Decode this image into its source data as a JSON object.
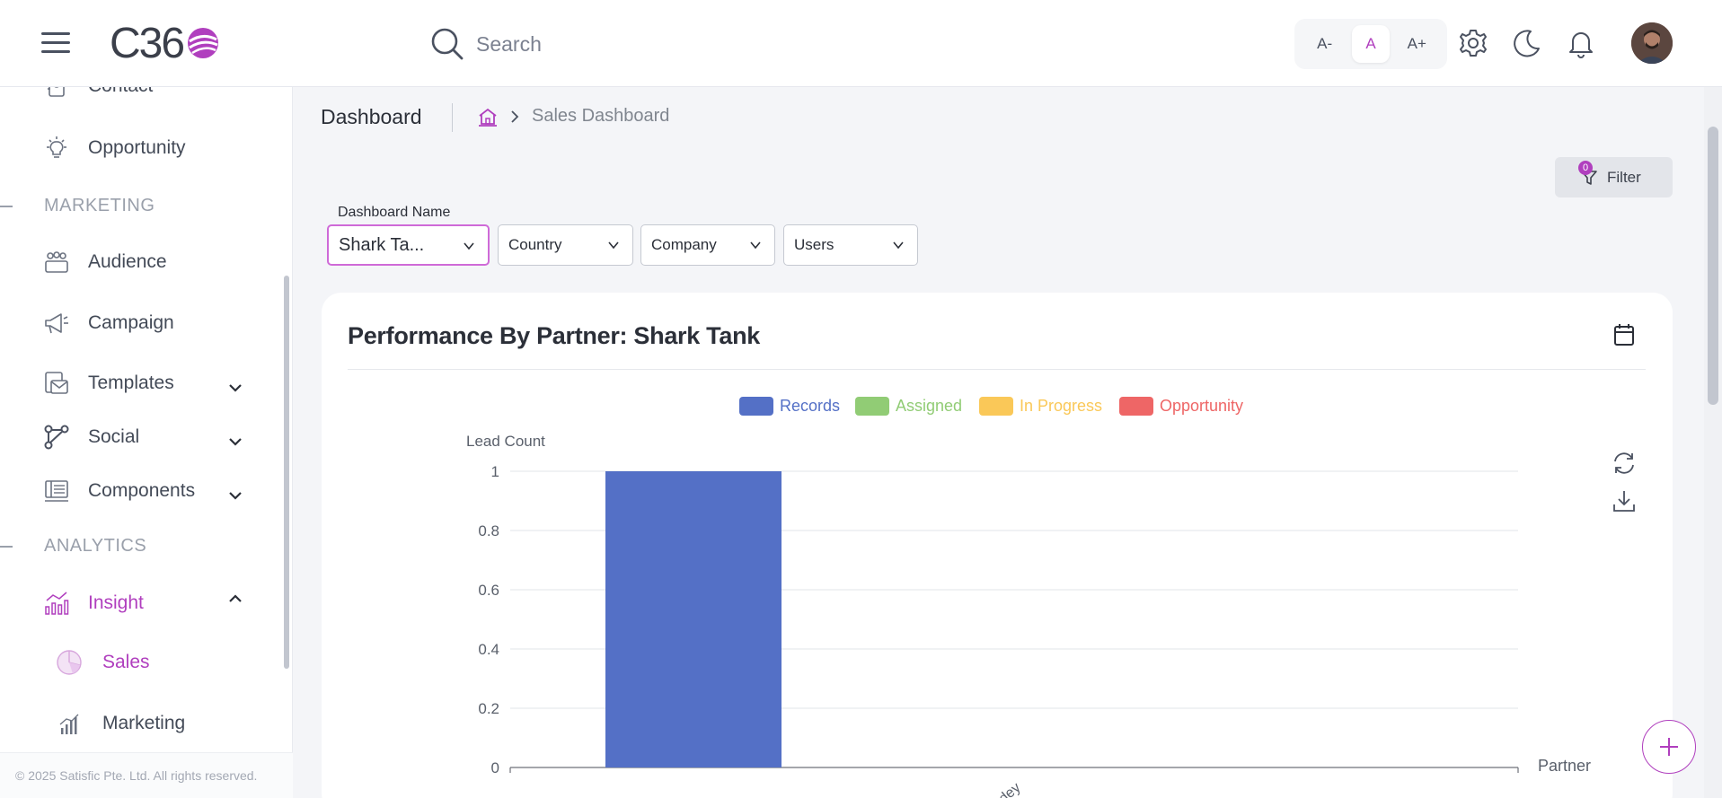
{
  "header": {
    "logo_text": "C36",
    "search_placeholder": "Search",
    "font_sizes": [
      "A-",
      "A",
      "A+"
    ],
    "active_font_size": "A"
  },
  "sidebar": {
    "items": [
      {
        "label": "Contact",
        "icon": "contact-icon"
      },
      {
        "label": "Opportunity",
        "icon": "lightbulb-icon"
      },
      {
        "section": "MARKETING"
      },
      {
        "label": "Audience",
        "icon": "audience-icon"
      },
      {
        "label": "Campaign",
        "icon": "megaphone-icon"
      },
      {
        "label": "Templates",
        "icon": "templates-icon",
        "expandable": true
      },
      {
        "label": "Social",
        "icon": "social-icon",
        "expandable": true
      },
      {
        "label": "Components",
        "icon": "components-icon",
        "expandable": true
      },
      {
        "section": "ANALYTICS"
      },
      {
        "label": "Insight",
        "icon": "insight-icon",
        "expanded": true,
        "active": true
      },
      {
        "label": "Sales",
        "icon": "pie-chart-icon",
        "sub": true,
        "active": true
      },
      {
        "label": "Marketing",
        "icon": "bar-chart-icon",
        "sub": true
      }
    ],
    "footer": "© 2025 Satisfic Pte. Ltd. All rights reserved."
  },
  "page": {
    "title": "Dashboard",
    "breadcrumb": "Sales Dashboard",
    "filter_label": "Filter",
    "filter_count": "0",
    "dashboard_name_label": "Dashboard Name",
    "selects": [
      {
        "value": "Shark Ta..."
      },
      {
        "value": "Country"
      },
      {
        "value": "Company"
      },
      {
        "value": "Users"
      }
    ]
  },
  "card": {
    "title": "Performance By Partner: Shark Tank"
  },
  "colors": {
    "accent": "#b03fbe",
    "records": "#5470c6",
    "assigned": "#91cc75",
    "in_progress": "#fac858",
    "opportunity": "#ee6666"
  },
  "chart_data": {
    "type": "bar",
    "title": "Performance By Partner: Shark Tank",
    "ylabel": "Lead Count",
    "xlabel": "Partner",
    "ylim": [
      0,
      1
    ],
    "yticks": [
      "0",
      "0.2",
      "0.4",
      "0.6",
      "0.8",
      "1"
    ],
    "categories": [
      "...dey"
    ],
    "legend_position": "top",
    "series": [
      {
        "name": "Records",
        "values": [
          1
        ]
      },
      {
        "name": "Assigned",
        "values": [
          0
        ]
      },
      {
        "name": "In Progress",
        "values": [
          0
        ]
      },
      {
        "name": "Opportunity",
        "values": [
          0
        ]
      }
    ]
  }
}
